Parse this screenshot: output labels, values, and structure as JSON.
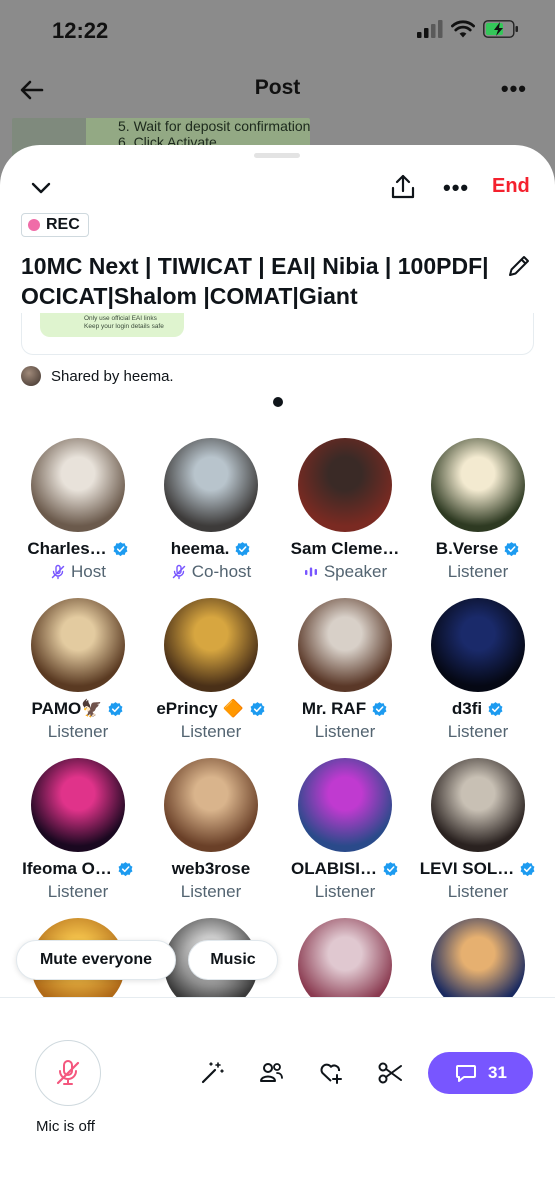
{
  "status": {
    "time": "12:22"
  },
  "background": {
    "title": "Post",
    "snippet_lines": [
      "5. Wait for deposit confirmation",
      "6. Click Activate"
    ]
  },
  "sheet": {
    "end_label": "End",
    "rec_label": "REC",
    "title": "10MC Next | TIWICAT | EAI| Nibia | 100PDF| OCICAT|Shalom |COMAT|Giant",
    "card_lines": [
      "Only use official EAI links",
      "Keep your login details safe"
    ],
    "shared_by": "Shared by heema."
  },
  "participants": [
    {
      "name": "Charles…",
      "role": "Host",
      "verified": true,
      "role_icon": "mic-off-icon",
      "role_color": "#7856ff",
      "avatar_colors": [
        "#e8e2da",
        "#6b5a4c"
      ]
    },
    {
      "name": "heema.",
      "role": "Co-host",
      "verified": true,
      "role_icon": "mic-off-icon",
      "role_color": "#7856ff",
      "avatar_colors": [
        "#b8c4cc",
        "#3d3b3a"
      ]
    },
    {
      "name": "Sam Cleme…",
      "role": "Speaker",
      "verified": false,
      "role_icon": "speaking-bars-icon",
      "role_color": "#7856ff",
      "avatar_colors": [
        "#3a2a26",
        "#7a2a22"
      ]
    },
    {
      "name": "B.Verse",
      "role": "Listener",
      "verified": true,
      "role_icon": "",
      "role_color": "#536471",
      "avatar_colors": [
        "#f3ead0",
        "#2e3a22"
      ]
    },
    {
      "name": "PAMO🦅",
      "role": "Listener",
      "verified": true,
      "role_icon": "",
      "role_color": "#536471",
      "avatar_colors": [
        "#e3cba0",
        "#5a3a22"
      ]
    },
    {
      "name": "ePrincy 🔶",
      "role": "Listener",
      "verified": true,
      "role_icon": "",
      "role_color": "#536471",
      "avatar_colors": [
        "#d7a640",
        "#4a3018"
      ]
    },
    {
      "name": "Mr. RAF",
      "role": "Listener",
      "verified": true,
      "role_icon": "",
      "role_color": "#536471",
      "avatar_colors": [
        "#d8d0c8",
        "#5a3828"
      ]
    },
    {
      "name": "d3fi",
      "role": "Listener",
      "verified": true,
      "role_icon": "",
      "role_color": "#536471",
      "avatar_colors": [
        "#1a2a6a",
        "#050814"
      ]
    },
    {
      "name": "Ifeoma O…",
      "role": "Listener",
      "verified": true,
      "role_icon": "",
      "role_color": "#536471",
      "avatar_colors": [
        "#e0338a",
        "#1a0820"
      ]
    },
    {
      "name": "web3rose",
      "role": "Listener",
      "verified": false,
      "role_icon": "",
      "role_color": "#536471",
      "avatar_colors": [
        "#d9b48c",
        "#6a4028"
      ]
    },
    {
      "name": "OLABISI…",
      "role": "Listener",
      "verified": true,
      "role_icon": "",
      "role_color": "#536471",
      "avatar_colors": [
        "#c03ad0",
        "#2a4a8a"
      ]
    },
    {
      "name": "LEVI SOL…",
      "role": "Listener",
      "verified": true,
      "role_icon": "",
      "role_color": "#536471",
      "avatar_colors": [
        "#c8c0b4",
        "#2a2220"
      ]
    },
    {
      "name": "",
      "role": "",
      "verified": false,
      "role_icon": "",
      "role_color": "#536471",
      "avatar_colors": [
        "#f2c04a",
        "#b06a18"
      ]
    },
    {
      "name": "",
      "role": "",
      "verified": false,
      "role_icon": "",
      "role_color": "#536471",
      "avatar_colors": [
        "#cfcfcf",
        "#3a3a3a"
      ]
    },
    {
      "name": "",
      "role": "",
      "verified": false,
      "role_icon": "",
      "role_color": "#536471",
      "avatar_colors": [
        "#e0c8d0",
        "#8a3a50"
      ]
    },
    {
      "name": "",
      "role": "",
      "verified": false,
      "role_icon": "",
      "role_color": "#536471",
      "avatar_colors": [
        "#e6b070",
        "#1a2a60"
      ]
    }
  ],
  "actions": {
    "mute_everyone": "Mute everyone",
    "music": "Music",
    "mic_status": "Mic is off",
    "comment_count": "31"
  },
  "colors": {
    "accent": "#7856ff",
    "end_red": "#f4212e",
    "verified_blue": "#1d9bf0",
    "rec_pink": "#f06ca8",
    "mic_off_pink": "#f4577e"
  }
}
